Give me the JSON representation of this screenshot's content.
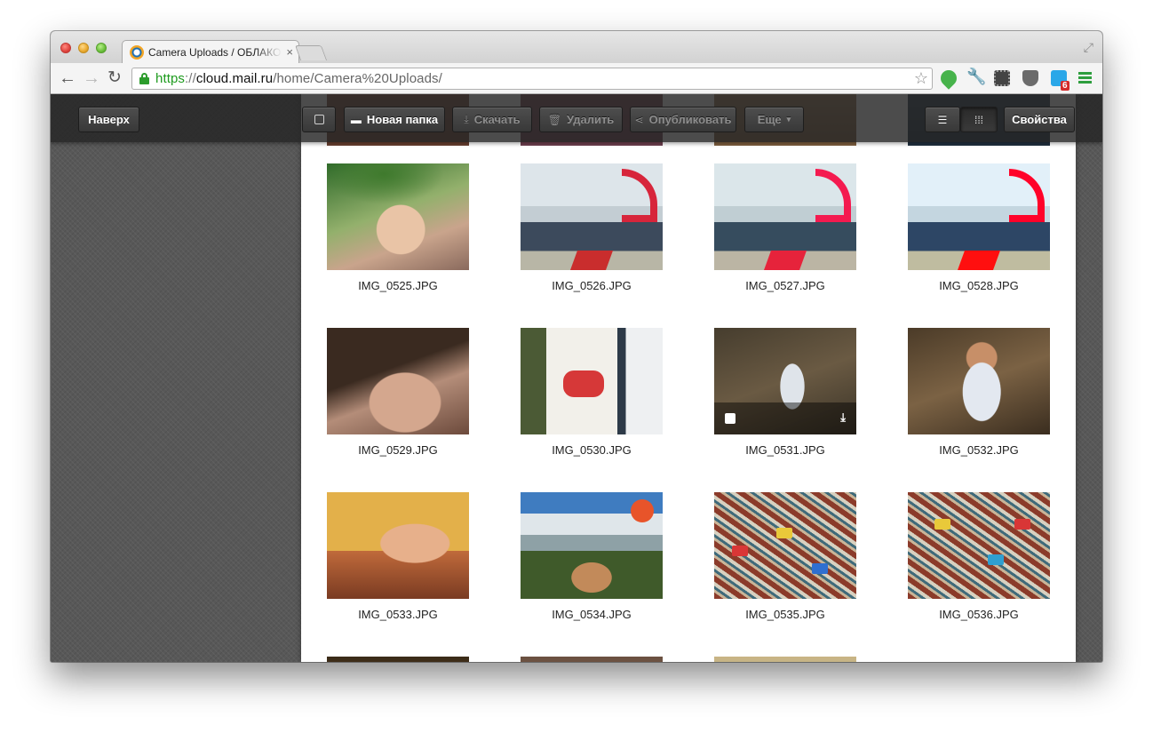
{
  "browser": {
    "tab_title": "Camera Uploads / ОБЛАКО",
    "tab_close": "×",
    "url_scheme": "https",
    "url_sep": "://",
    "url_host": "cloud.mail.ru",
    "url_path": "/home/Camera%20Uploads/",
    "star_icon": "☆",
    "back_icon": "←",
    "forward_icon": "→",
    "reload_icon": "↻",
    "fullscreen_icon": "⤢",
    "wrench_icon": "🔧",
    "ext_badge": "6"
  },
  "toolbar": {
    "up_label": "Наверх",
    "new_folder_label": "Новая папка",
    "download_label": "Скачать",
    "delete_label": "Удалить",
    "publish_label": "Опубликовать",
    "more_label": "Еще",
    "properties_label": "Свойства",
    "folder_icon": "▬",
    "download_icon": "⤓",
    "delete_icon": "🗑",
    "share_icon": "⋖",
    "list_icon": "☰",
    "grid_icon": "⁞⁞⁞",
    "chevron_icon": "▾"
  },
  "files": [
    {
      "name": "IMG_0525.JPG"
    },
    {
      "name": "IMG_0526.JPG"
    },
    {
      "name": "IMG_0527.JPG"
    },
    {
      "name": "IMG_0528.JPG"
    },
    {
      "name": "IMG_0529.JPG"
    },
    {
      "name": "IMG_0530.JPG"
    },
    {
      "name": "IMG_0531.JPG"
    },
    {
      "name": "IMG_0532.JPG"
    },
    {
      "name": "IMG_0533.JPG"
    },
    {
      "name": "IMG_0534.JPG"
    },
    {
      "name": "IMG_0535.JPG"
    },
    {
      "name": "IMG_0536.JPG"
    }
  ],
  "hover_download_icon": "⤓",
  "colors": {
    "url_scheme": "#1e9b1e",
    "page_background": "#585858",
    "overlay": "#242424"
  }
}
